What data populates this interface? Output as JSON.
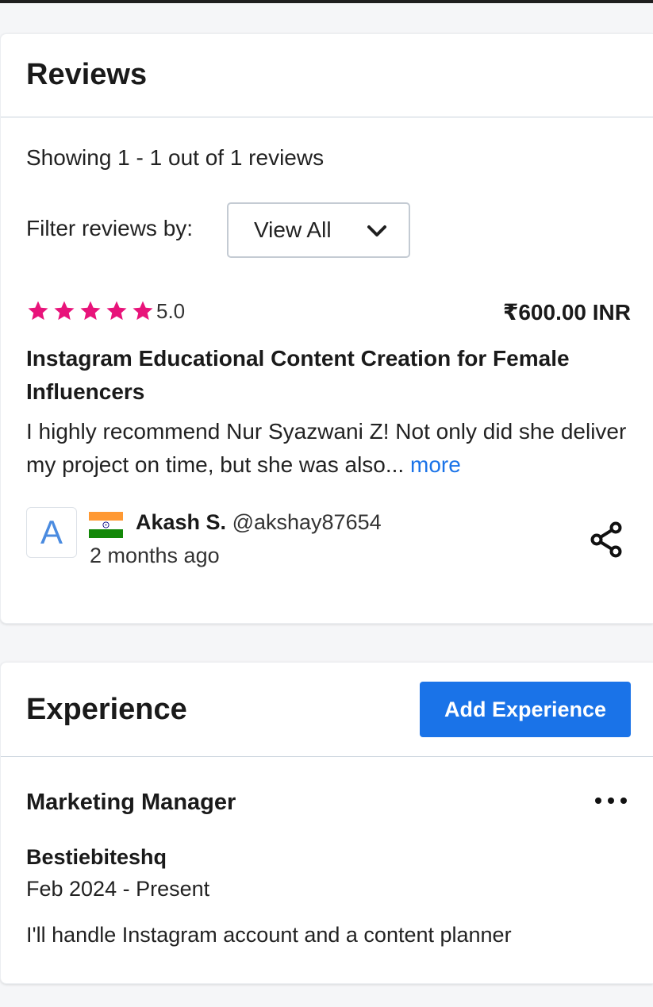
{
  "reviews": {
    "title": "Reviews",
    "showing_text": "Showing 1 - 1 out of 1 reviews",
    "filter_label": "Filter reviews by:",
    "filter_value": "View All",
    "items": [
      {
        "rating": "5.0",
        "stars": 5,
        "price": "₹600.00 INR",
        "title": "Instagram Educational Content Creation for Female Influencers",
        "text": "I highly recommend Nur Syazwani Z! Not only did she deliver my project on time, but she was also...",
        "more_label": "more",
        "avatar_letter": "A",
        "reviewer_name": "Akash S.",
        "reviewer_handle": "@akshay87654",
        "date": "2 months ago",
        "flag_icon": "india-flag-icon"
      }
    ]
  },
  "experience": {
    "title": "Experience",
    "add_button_label": "Add Experience",
    "items": [
      {
        "job_title": "Marketing Manager",
        "company": "Bestiebiteshq",
        "dates": "Feb 2024 - Present",
        "description": "I'll handle Instagram account and a content planner"
      }
    ]
  },
  "colors": {
    "accent": "#1a73e8",
    "star": "#e8137a",
    "card_bg": "#ffffff",
    "page_bg": "#f5f6f8"
  }
}
